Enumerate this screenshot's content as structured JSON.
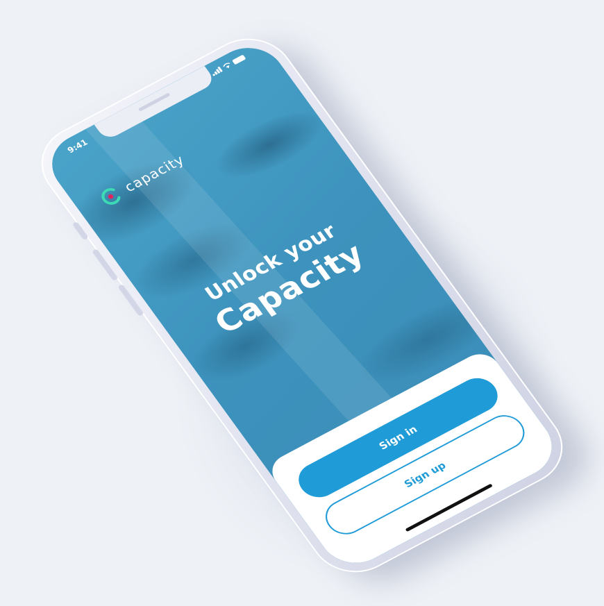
{
  "status_bar": {
    "time": "9:41"
  },
  "brand": {
    "name": "capacity",
    "logo_icon": "capacity-logo-icon",
    "logo_ring_color": "#3ddbb5",
    "logo_dot_color": "#e0245e"
  },
  "hero": {
    "line1": "Unlock your",
    "line2": "Capacity"
  },
  "actions": {
    "sign_in": "Sign in",
    "sign_up": "Sign up"
  },
  "colors": {
    "background": "#eef1f6",
    "screen_overlay": "#3f96bf",
    "primary": "#1f9bd7"
  }
}
